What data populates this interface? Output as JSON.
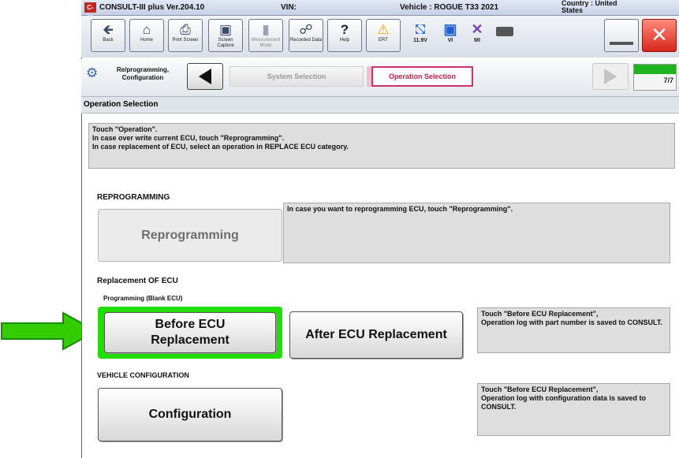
{
  "titlebar": {
    "app_icon": "C-III",
    "app_name": "CONSULT-III plus  Ver.204.10",
    "vin_label": "VIN:",
    "vehicle": "Vehicle : ROGUE T33 2021",
    "country": "Country : United States"
  },
  "toolbar": {
    "back": "Back",
    "home": "Home",
    "print_screen": "Print Screen",
    "screen_capture": "Screen Capture",
    "measurement_mode": "Measurement Mode",
    "recorded_data": "Recorded Data",
    "help": "Help",
    "ert": "ERT",
    "voltage": "11.9V",
    "vi": "VI",
    "mi": "MI"
  },
  "breadcrumb": {
    "reprog_config": "Re/programming, Configuration",
    "system_selection": "System Selection",
    "operation_selection": "Operation Selection",
    "step": "7/7"
  },
  "section_title": "Operation Selection",
  "instructions": "Touch \"Operation\".\nIn case over write current ECU, touch \"Reprogramming\".\nIn case replacement of ECU, select an operation in REPLACE ECU category.",
  "reprogramming": {
    "heading": "REPROGRAMMING",
    "button": "Reprogramming",
    "note": "In case you want to reprogramming ECU, touch \"Reprogramming\"."
  },
  "replacement": {
    "heading": "Replacement OF ECU",
    "subheading": "Programming (Blank ECU)",
    "before_button": "Before ECU Replacement",
    "after_button": "After ECU Replacement",
    "note": "Touch \"Before ECU Replacement\",\nOperation log with part number is saved to CONSULT."
  },
  "configuration": {
    "heading": "VEHICLE CONFIGURATION",
    "button": "Configuration",
    "note": "Touch \"Before ECU Replacement\",\nOperation log with configuration data is saved to CONSULT."
  },
  "colors": {
    "highlight": "#22dd00",
    "arrow": "#33cc00",
    "active_crumb_border": "#d0306a",
    "progress": "#1fb31f"
  },
  "icons": {
    "back": "back-arrow-icon",
    "home": "home-icon",
    "print": "printer-icon",
    "camera": "camera-icon",
    "help": "question-icon",
    "warning": "warning-icon",
    "car": "car-battery-icon",
    "signal": "signal-icon",
    "close": "close-icon"
  }
}
